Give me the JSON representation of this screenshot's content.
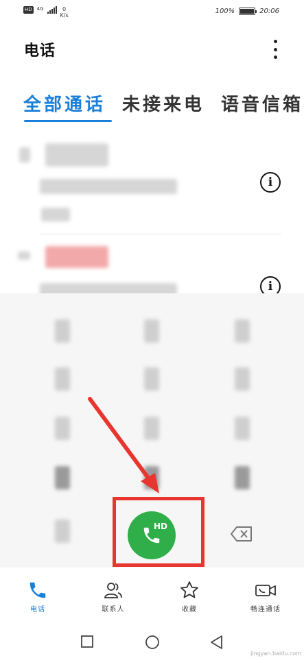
{
  "status_bar": {
    "hd_badge": "HD",
    "network": "4G",
    "speed_value": "0",
    "speed_unit": "K/s",
    "battery_text": "100%",
    "battery_level": 1.0,
    "time": "20:06"
  },
  "header": {
    "title": "电话",
    "more_icon": "more-vert-icon"
  },
  "tabs": [
    {
      "label": "全部通话",
      "active": true
    },
    {
      "label": "未接来电",
      "active": false
    },
    {
      "label": "语音信箱",
      "active": false
    }
  ],
  "call_log": {
    "info_icon_glyph": "i"
  },
  "dialpad": {
    "call_button_label": "HD",
    "call_icon": "phone-icon",
    "backspace_icon": "backspace-icon"
  },
  "bottom_nav": [
    {
      "label": "电话",
      "icon": "phone-icon",
      "active": true
    },
    {
      "label": "联系人",
      "icon": "contacts-icon",
      "active": false
    },
    {
      "label": "收藏",
      "icon": "star-icon",
      "active": false
    },
    {
      "label": "畅连通话",
      "icon": "video-call-icon",
      "active": false
    }
  ],
  "watermark": "jingyan.baidu.com",
  "colors": {
    "accent": "#1a7fd9",
    "call_green": "#2fae4a",
    "highlight_red": "#e8352f"
  }
}
